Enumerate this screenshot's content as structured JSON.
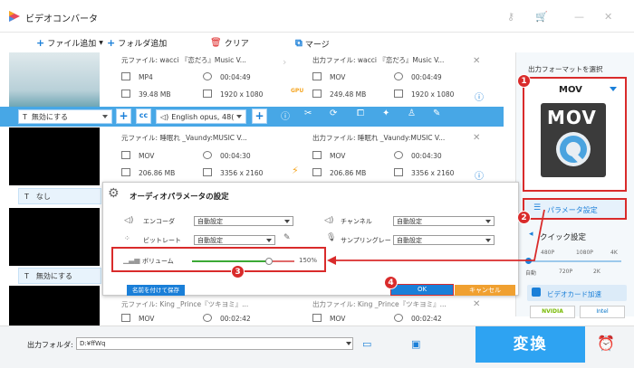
{
  "app": {
    "title": "ビデオコンバータ"
  },
  "toolbar": {
    "add_file": "ファイル追加",
    "add_folder": "フォルダ追加",
    "clear": "クリア",
    "merge": "マージ"
  },
  "files": [
    {
      "src_name": "元ファイル: wacci 『恋だろ』Music V...",
      "src_format": "MP4",
      "src_duration": "00:04:49",
      "src_size": "39.48 MB",
      "src_res": "1920 x 1080",
      "out_name": "出力ファイル: wacci 『恋だろ』Music V...",
      "out_format": "MOV",
      "out_duration": "00:04:49",
      "out_size": "249.48 MB",
      "out_res": "1920 x 1080",
      "accel_label": "GPU"
    },
    {
      "src_name": "元ファイル: 睡眠れ _Vaundy:MUSIC V...",
      "src_format": "MOV",
      "src_duration": "00:04:30",
      "src_size": "206.86 MB",
      "src_res": "3356 x 2160",
      "out_name": "出力ファイル: 睡眠れ _Vaundy:MUSIC V...",
      "out_format": "MOV",
      "out_duration": "00:04:30",
      "out_size": "206.86 MB",
      "out_res": "3356 x 2160"
    },
    {
      "src_name": "元ファイル: King _Prince『ツキヨミ』...",
      "src_format": "MOV",
      "src_duration": "00:02:42",
      "out_name": "出力ファイル: King _Prince『ツキヨミ』...",
      "out_format": "MOV",
      "out_duration": "00:02:42"
    }
  ],
  "edit_bar": {
    "subtitle": "無効にする",
    "audio": "English opus, 48(",
    "subtitle2": "なし",
    "subtitle3": "無効にする"
  },
  "dialog": {
    "title": "オーディオパラメータの設定",
    "encoder_label": "エンコーダ",
    "encoder_value": "自動設定",
    "bitrate_label": "ビットレート",
    "bitrate_value": "自動設定",
    "channel_label": "チャンネル",
    "channel_value": "自動設定",
    "samplerate_label": "サンプリングレート",
    "samplerate_value": "自動設定",
    "volume_label": "ボリューム",
    "volume_value": "150%",
    "volume_level": 0.75,
    "save_as": "名前を付けて保存",
    "ok": "OK",
    "cancel": "キャンセル"
  },
  "right_panel": {
    "format_heading": "出力フォーマットを選択",
    "format": "MOV",
    "format_icon": "MOV",
    "param_button": "パラメータ設定",
    "quick_heading": "クイック設定",
    "quality_top": [
      "480P",
      "1080P",
      "4K"
    ],
    "quality_bottom": [
      "自動",
      "720P",
      "2K"
    ],
    "accel_heading": "ビデオカード加速",
    "accel_options": [
      "NVIDIA",
      "Intel"
    ]
  },
  "bottom": {
    "output_label": "出力フォルダ:",
    "output_path": "D:¥ffWq",
    "convert": "変換"
  },
  "badges": [
    "1",
    "2",
    "3",
    "4"
  ],
  "colors": {
    "accent": "#1a7fd8",
    "convert_bg": "#2ea3f2",
    "highlight": "#d92b2b",
    "edit_bar": "#47a7e6",
    "cancel": "#f0a030"
  }
}
